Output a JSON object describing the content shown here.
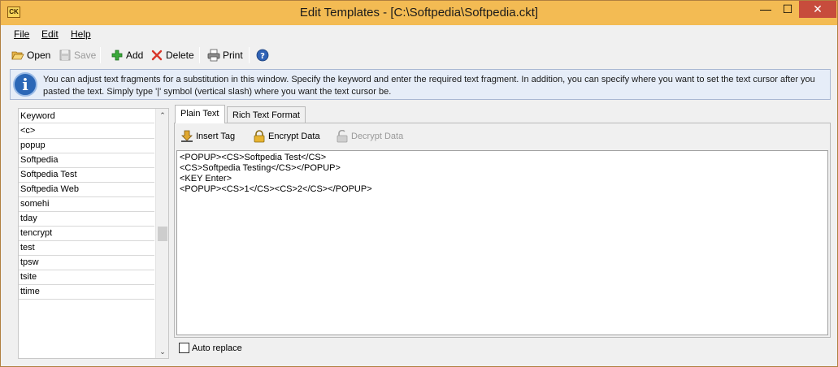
{
  "window": {
    "title": "Edit Templates - [C:\\Softpedia\\Softpedia.ckt]",
    "app_icon_text": "CK",
    "minimize_glyph": "—",
    "maximize_glyph": "☐",
    "close_glyph": "✕"
  },
  "menu": {
    "file": "File",
    "edit": "Edit",
    "help": "Help"
  },
  "toolbar": {
    "open": "Open",
    "save": "Save",
    "add": "Add",
    "delete": "Delete",
    "print": "Print"
  },
  "info": {
    "icon": "i",
    "text": "You can adjust text fragments for a substitution in this window. Specify the keyword and enter the required text fragment. In addition, you can specify where you want to set the text cursor after you pasted the text. Simply type '|' symbol (vertical slash) where you want the text cursor be."
  },
  "keyword_list": {
    "header": "Keyword",
    "items": [
      "<c>",
      "popup",
      "Softpedia",
      "Softpedia Test",
      "Softpedia Web",
      "somehi",
      "tday",
      "tencrypt",
      "test",
      "tpsw",
      "tsite",
      "ttime"
    ],
    "scroll_up": "⌃",
    "scroll_down": "⌄"
  },
  "tabs": {
    "plain_text": "Plain Text",
    "rich_text": "Rich Text Format"
  },
  "editor_toolbar": {
    "insert_tag": "Insert Tag",
    "encrypt": "Encrypt Data",
    "decrypt": "Decrypt Data"
  },
  "editor": {
    "content": "<POPUP><CS>Softpedia Test</CS>\n<CS>Softpedia Testing</CS></POPUP>\n<KEY Enter>\n<POPUP><CS>1</CS><CS>2</CS></POPUP>"
  },
  "auto_replace": {
    "label": "Auto replace",
    "checked": false
  },
  "icons": {
    "open": "folder-open-icon",
    "save": "floppy-disk-icon",
    "add": "plus-icon",
    "delete": "delete-x-icon",
    "print": "printer-icon",
    "help": "help-icon",
    "info": "info-icon",
    "insert_tag": "insert-tag-icon",
    "encrypt": "lock-icon",
    "decrypt": "unlock-icon"
  },
  "colors": {
    "titlebar": "#f3bb53",
    "close_button": "#c74c3c",
    "info_bg": "#e6edf8",
    "info_icon": "#2b67b7"
  }
}
